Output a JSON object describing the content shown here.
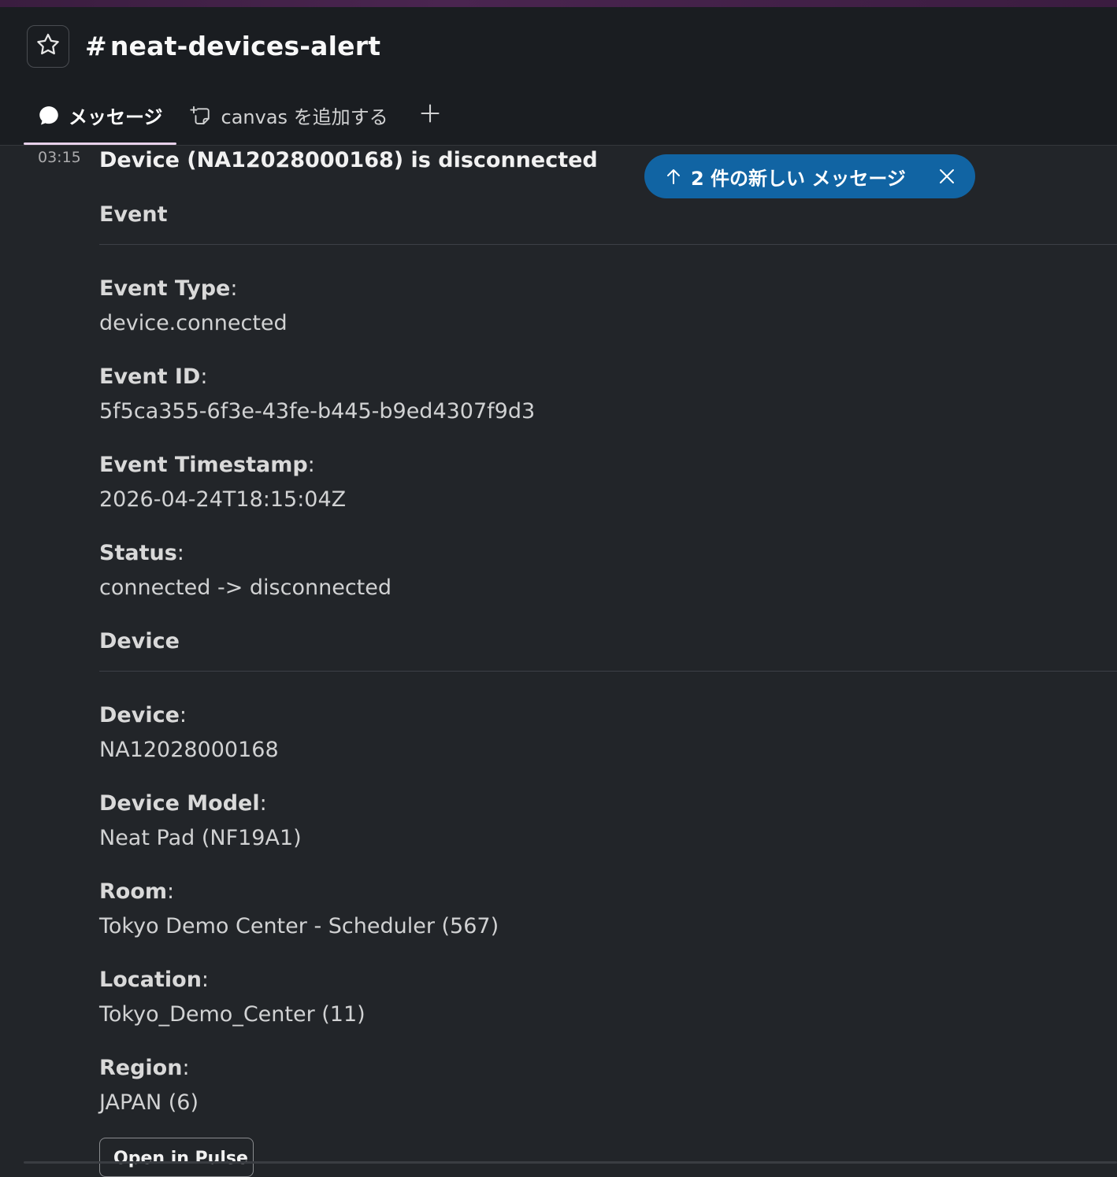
{
  "header": {
    "channel_hash": "#",
    "channel_name": "neat-devices-alert",
    "tabs": [
      {
        "label": "メッセージ",
        "icon": "chat-bubble-icon",
        "active": true
      },
      {
        "label": "canvas を追加する",
        "icon": "canvas-add-icon",
        "active": false
      }
    ],
    "add_tab_icon": "plus-icon"
  },
  "new_messages_banner": {
    "label": "2 件の新しい メッセージ",
    "arrow_icon": "arrow-up-icon",
    "close_icon": "close-icon",
    "color": "#1164a3"
  },
  "message": {
    "time": "03:15",
    "title": "Device (NA12028000168) is disconnected",
    "sections": {
      "event": "Event",
      "device": "Device"
    },
    "fields": {
      "event_type": {
        "label": "Event Type",
        "value": "device.connected"
      },
      "event_id": {
        "label": "Event ID",
        "value": "5f5ca355-6f3e-43fe-b445-b9ed4307f9d3"
      },
      "event_timestamp": {
        "label": "Event Timestamp",
        "value": "2026-04-24T18:15:04Z"
      },
      "status": {
        "label": "Status",
        "value": "connected -> disconnected"
      },
      "device": {
        "label": "Device",
        "value": "NA12028000168"
      },
      "device_model": {
        "label": "Device Model",
        "value": "Neat Pad (NF19A1)"
      },
      "room": {
        "label": "Room",
        "value": "Tokyo Demo Center - Scheduler (567)"
      },
      "location": {
        "label": "Location",
        "value": "Tokyo_Demo_Center (11)"
      },
      "region": {
        "label": "Region",
        "value": "JAPAN (6)"
      }
    },
    "colon": ":",
    "button": "Open in Pulse"
  }
}
